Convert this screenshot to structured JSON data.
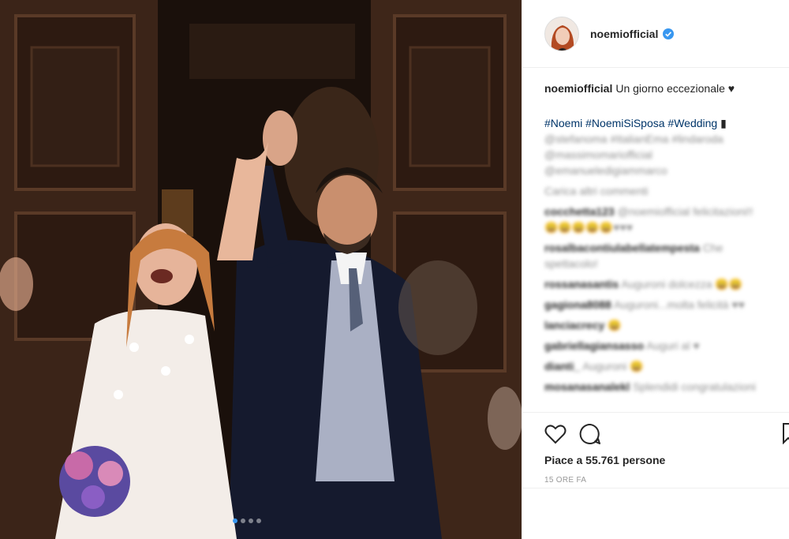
{
  "post": {
    "username": "noemiofficial",
    "verified": true,
    "caption_text": "Un giorno eccezionale",
    "caption_emoji": "♥",
    "hashtags": "#Noemi #NoemiSiSposa #Wedding",
    "hashtag_emoji": "▮",
    "tags_line1": "@stefanoma #ItalianEma #lindaroda",
    "tags_line2": "@massimomariofficial",
    "tags_line3": "@emanueledigiammarco",
    "load_more": "Carica altri commenti",
    "comments": [
      {
        "user": "cocchetta123",
        "text": "@noemiofficial felicitazioni!!"
      },
      {
        "user": "",
        "text": "😀😀😀😀😀♥♥♥"
      },
      {
        "user": "rosalbacontiulabellatempesta",
        "text": "Che"
      },
      {
        "user": "",
        "text": "spettacolo!"
      },
      {
        "user": "rossanasantis",
        "text": "Auguroni dolcezza 😀😀"
      },
      {
        "user": "gagiona8088",
        "text": "Auguroni...molta felicità ♥♥"
      },
      {
        "user": "lanciacrecy",
        "text": "😀"
      },
      {
        "user": "gabriellagiansasso",
        "text": "Auguri al ♥"
      },
      {
        "user": "dianti_",
        "text": "Auguroni 😀"
      },
      {
        "user": "mosanasanalekl",
        "text": "Splendidi congratulazioni"
      }
    ],
    "likes": "Piace a 55.761 persone",
    "time": "15 ORE FA",
    "carousel_count": 4,
    "carousel_active": 0
  },
  "icons": {
    "like": "heart-icon",
    "comment": "comment-icon",
    "save": "bookmark-icon",
    "verified": "verified-badge-icon"
  },
  "colors": {
    "verified": "#3897f0",
    "hashtag": "#003569",
    "muted": "#999999",
    "border": "#efefef"
  }
}
